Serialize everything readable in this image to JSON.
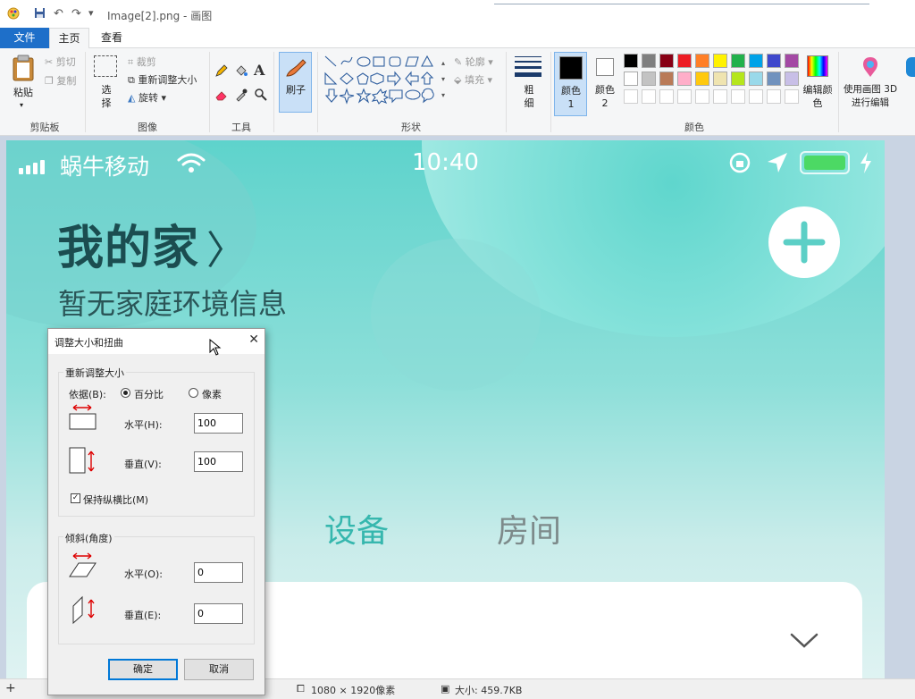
{
  "window": {
    "title": "Image[2].png - 画图",
    "quick_access": {
      "undo": "↶",
      "redo": "↷",
      "customize": "▾"
    }
  },
  "tabs": [
    {
      "label": "文件",
      "active": false
    },
    {
      "label": "主页",
      "active": true
    },
    {
      "label": "查看",
      "active": false
    }
  ],
  "ribbon": {
    "clipboard": {
      "paste": "粘贴",
      "cut": "剪切",
      "copy": "复制",
      "group": "剪贴板"
    },
    "image": {
      "select": "选择",
      "crop": "裁剪",
      "resize": "重新调整大小",
      "rotate": "旋转",
      "group": "图像"
    },
    "tools": {
      "group": "工具"
    },
    "brushes": {
      "label": "刷子"
    },
    "shapes": {
      "outline": "轮廓",
      "fill": "填充",
      "group": "形状"
    },
    "size": {
      "label": "粗细"
    },
    "colors": {
      "color1": "颜色 1",
      "color2": "颜色 2",
      "edit": "编辑颜色",
      "paint3d": "使用画图 3D 进行编辑",
      "group": "颜色",
      "palette_row1": [
        "#000000",
        "#7f7f7f",
        "#880015",
        "#ed1c24",
        "#ff7f27",
        "#fff200",
        "#22b14c",
        "#00a2e8",
        "#3f48cc",
        "#a349a4"
      ],
      "palette_row2": [
        "#ffffff",
        "#c3c3c3",
        "#b97a57",
        "#ffaec9",
        "#ffc90e",
        "#efe4b0",
        "#b5e61d",
        "#99d9ea",
        "#7092be",
        "#c8bfe7"
      ]
    }
  },
  "canvas": {
    "status": {
      "carrier": "蜗牛移动",
      "time": "10:40"
    },
    "home_title": "我的家",
    "home_subtitle": "暂无家庭环境信息",
    "segment_devices": "设备",
    "segment_rooms": "房间"
  },
  "statusbar": {
    "dimensions": "1080 × 1920像素",
    "filesize": "大小: 459.7KB"
  },
  "dialog": {
    "title": "调整大小和扭曲",
    "resize_group": "重新调整大小",
    "by_label": "依据(B):",
    "percent": "百分比",
    "pixels": "像素",
    "horizontal_label": "水平(H):",
    "horizontal_value": "100",
    "vertical_label": "垂直(V):",
    "vertical_value": "100",
    "keep_ratio": "保持纵横比(M)",
    "skew_group": "倾斜(角度)",
    "skew_h_label": "水平(O):",
    "skew_h_value": "0",
    "skew_v_label": "垂直(E):",
    "skew_v_value": "0",
    "ok": "确定",
    "cancel": "取消"
  }
}
